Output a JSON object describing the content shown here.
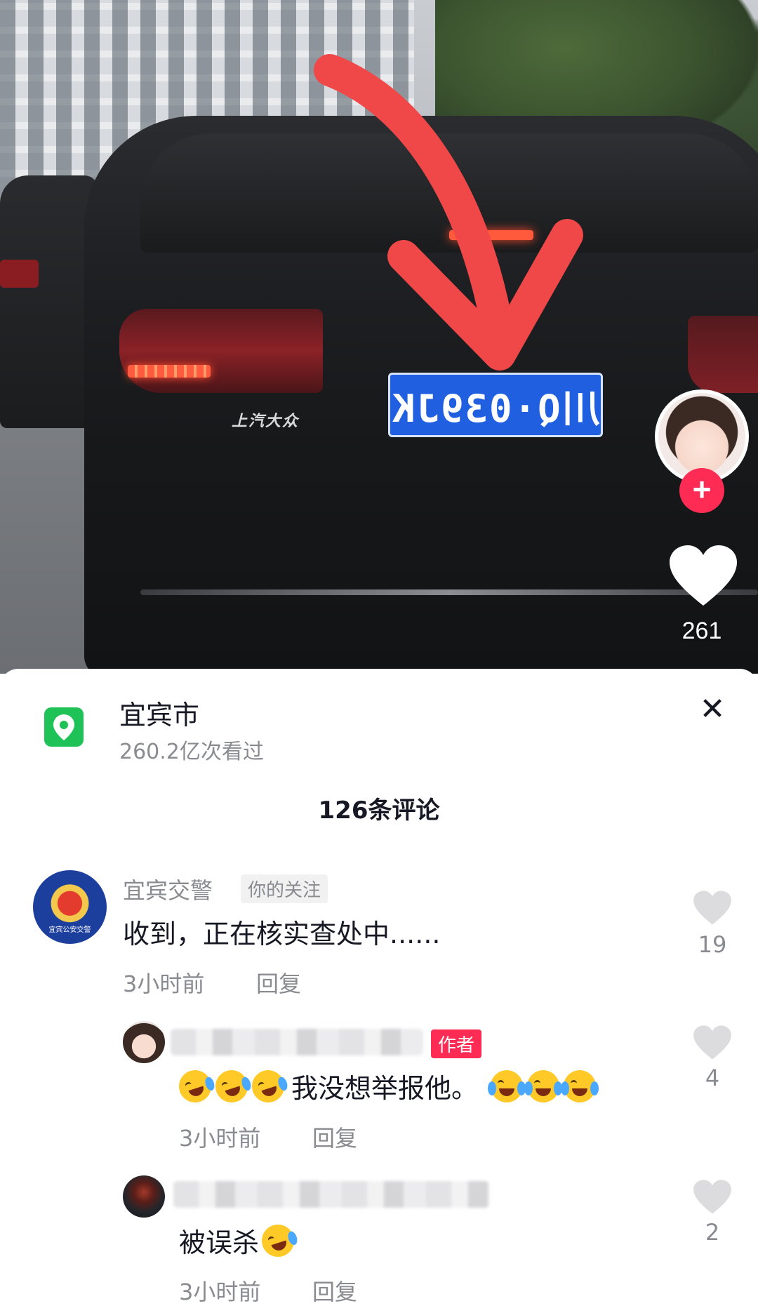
{
  "video": {
    "plate_text": "川Q·039JK",
    "car_badge": "上汽大众",
    "like_count": "261"
  },
  "sheet": {
    "location_title": "宜宾市",
    "location_views": "260.2亿次看过",
    "comment_count_title": "126条评论",
    "close_icon": "close-icon"
  },
  "comments": [
    {
      "name": "宜宾交警",
      "tag": "你的关注",
      "avatar_text": "宜宾公安交警",
      "text": "收到，正在核实查处中......",
      "time": "3小时前",
      "reply": "回复",
      "likes": "19"
    },
    {
      "tag": "作者",
      "text": "我没想举报他。",
      "time": "3小时前",
      "reply": "回复",
      "likes": "4"
    },
    {
      "text": "被误杀",
      "time": "3小时前",
      "reply": "回复",
      "likes": "2"
    }
  ],
  "colors": {
    "accent": "#fe2c55",
    "location_green": "#1fc256",
    "plate_blue": "#1f5fe0",
    "arrow_red": "#f04848"
  }
}
